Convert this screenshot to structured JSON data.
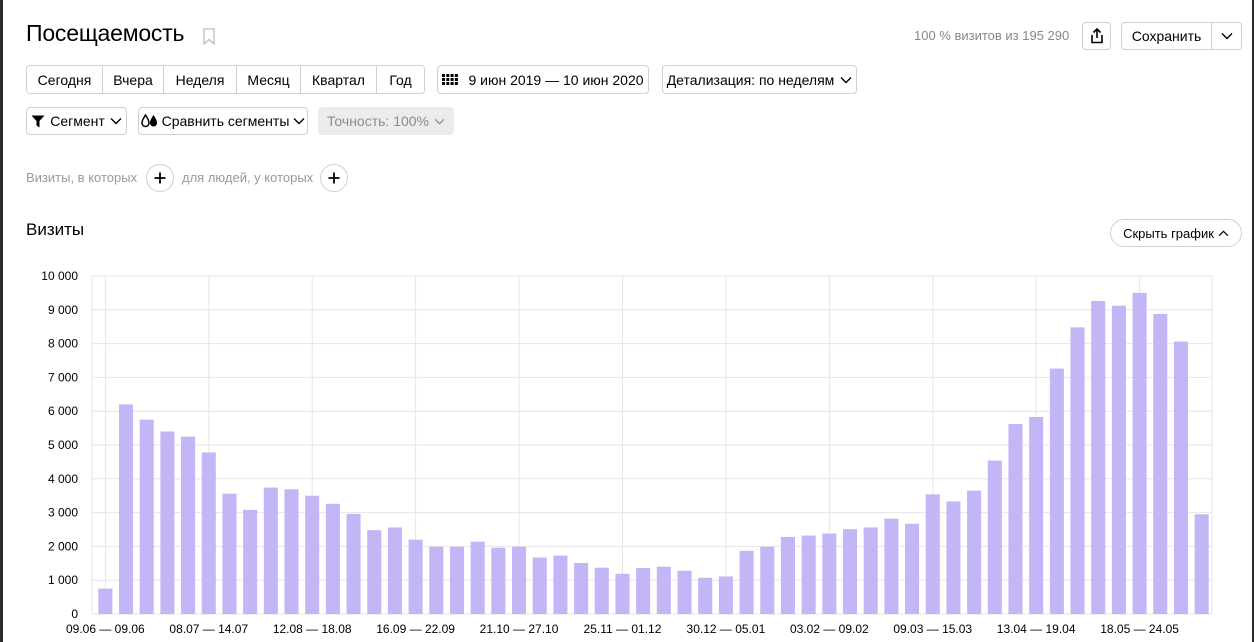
{
  "header": {
    "title": "Посещаемость",
    "visits_note": "100 % визитов из 195 290",
    "save_label": "Сохранить"
  },
  "periods": [
    "Сегодня",
    "Вчера",
    "Неделя",
    "Месяц",
    "Квартал",
    "Год"
  ],
  "date_range": "9 июн 2019 — 10 июн 2020",
  "detail_label": "Детализация: по неделям",
  "segment_label": "Сегмент",
  "compare_label": "Сравнить сегменты",
  "accuracy_label": "Точность: 100%",
  "conditions": {
    "visits_text": "Визиты, в которых",
    "people_text": "для людей, у которых"
  },
  "section": {
    "title": "Визиты",
    "hide_chart_label": "Скрыть график"
  },
  "colors": {
    "bar": "#c4b5f7",
    "grid": "#e6e6e6"
  },
  "icons": {
    "bookmark": "bookmark-icon",
    "share": "share-icon",
    "calendar": "calendar-icon",
    "filter": "filter-icon",
    "compare": "compare-icon",
    "chevron": "chevron-down-icon",
    "chevron_up": "chevron-up-icon",
    "plus": "plus-icon"
  },
  "chart_data": {
    "type": "bar",
    "title": "Визиты",
    "ylim": [
      0,
      10000
    ],
    "yticks": [
      0,
      1000,
      2000,
      3000,
      4000,
      5000,
      6000,
      7000,
      8000,
      9000,
      10000
    ],
    "ytick_labels": [
      "0",
      "1 000",
      "2 000",
      "3 000",
      "4 000",
      "5 000",
      "6 000",
      "7 000",
      "8 000",
      "9 000",
      "10 000"
    ],
    "tick_labels": [
      {
        "index": 0,
        "label": "09.06 — 09.06"
      },
      {
        "index": 5,
        "label": "08.07 — 14.07"
      },
      {
        "index": 10,
        "label": "12.08 — 18.08"
      },
      {
        "index": 15,
        "label": "16.09 — 22.09"
      },
      {
        "index": 20,
        "label": "21.10 — 27.10"
      },
      {
        "index": 25,
        "label": "25.11 — 01.12"
      },
      {
        "index": 30,
        "label": "30.12 — 05.01"
      },
      {
        "index": 35,
        "label": "03.02 — 09.02"
      },
      {
        "index": 40,
        "label": "09.03 — 15.03"
      },
      {
        "index": 45,
        "label": "13.04 — 19.04"
      },
      {
        "index": 50,
        "label": "18.05 — 24.05"
      }
    ],
    "values": [
      750,
      6200,
      5750,
      5400,
      5250,
      4780,
      3560,
      3080,
      3740,
      3690,
      3500,
      3260,
      2960,
      2480,
      2560,
      2200,
      1990,
      1990,
      2140,
      1960,
      1990,
      1670,
      1730,
      1510,
      1370,
      1190,
      1360,
      1400,
      1280,
      1070,
      1110,
      1870,
      1990,
      2280,
      2320,
      2380,
      2510,
      2560,
      2820,
      2670,
      3540,
      3330,
      3650,
      4540,
      5620,
      5830,
      7260,
      8480,
      9260,
      9120,
      9500,
      8880,
      8060,
      2950
    ]
  }
}
